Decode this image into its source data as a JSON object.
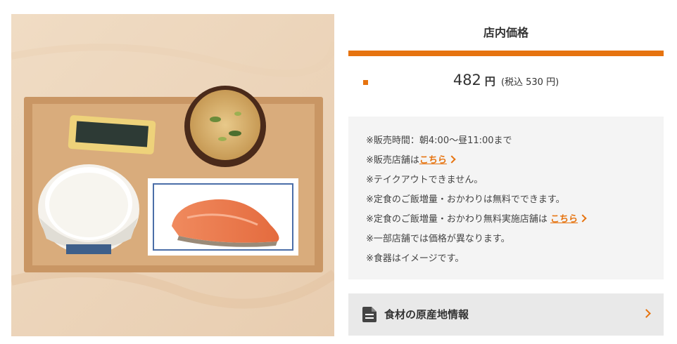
{
  "price_section": {
    "header": "店内価格",
    "price": "482",
    "yen": "円",
    "tax_included": "(税込 530 円)",
    "accent_color": "#e6730f"
  },
  "notes": {
    "sales_time": "※販売時間：朝4:00〜昼11:00まで",
    "stores_prefix": "※販売店舗は",
    "stores_link": "こちら",
    "takeout": "※テイクアウトできません。",
    "rice_free": "※定食のご飯増量・おかわりは無料でできます。",
    "rice_stores_prefix": "※定食のご飯増量・おかわり無料実施店舗は",
    "rice_stores_link": "こちら",
    "price_diff": "※一部店舗では価格が異なります。",
    "dish_image": "※食器はイメージです。"
  },
  "origin_info": {
    "label": "食材の原産地情報",
    "icon": "document-icon"
  }
}
